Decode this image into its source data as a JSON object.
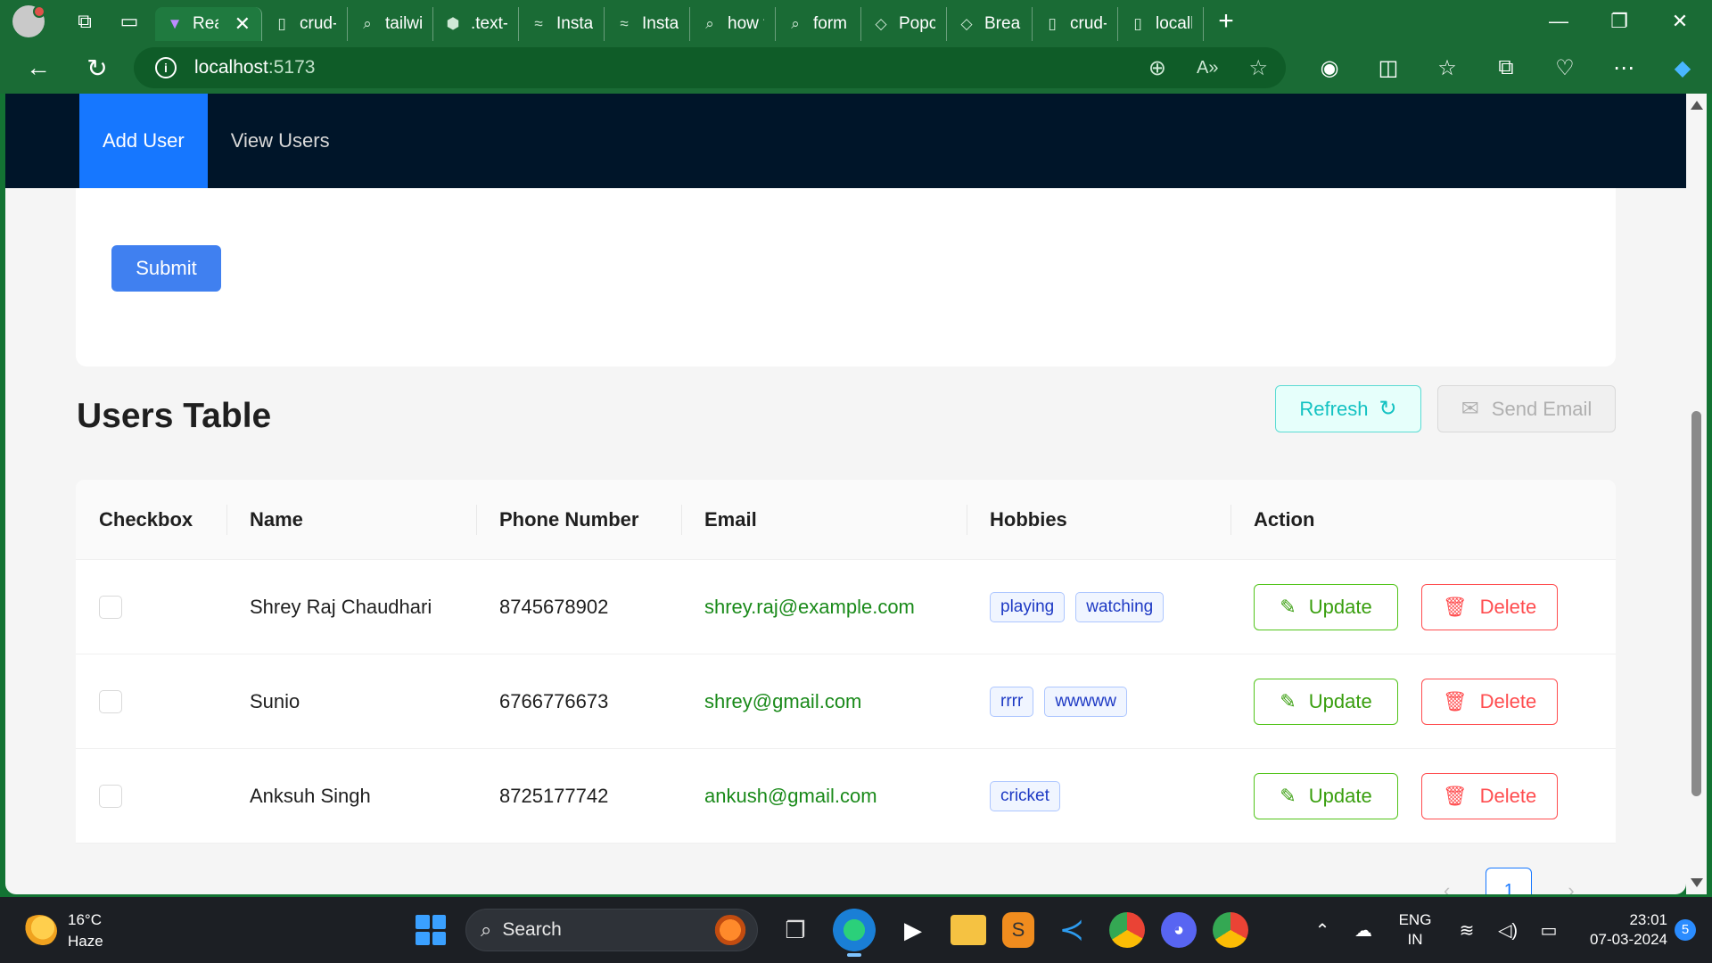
{
  "browser": {
    "tabs": [
      {
        "label": "Rea",
        "icon": "vite-icon",
        "active": true
      },
      {
        "label": "crud-us",
        "icon": "page-icon"
      },
      {
        "label": "tailwind",
        "icon": "search-icon"
      },
      {
        "label": ".text-blu",
        "icon": "cube-icon"
      },
      {
        "label": "Install T",
        "icon": "tailwind-icon"
      },
      {
        "label": "Install T",
        "icon": "tailwind-icon"
      },
      {
        "label": "how to",
        "icon": "search-icon"
      },
      {
        "label": "form de",
        "icon": "search-icon"
      },
      {
        "label": "Popcon",
        "icon": "diamond-icon"
      },
      {
        "label": "Breadcr",
        "icon": "diamond-icon"
      },
      {
        "label": "crud-us",
        "icon": "page-icon"
      },
      {
        "label": "localho",
        "icon": "page-icon"
      }
    ],
    "url_host": "localhost",
    "url_port": ":5173"
  },
  "app": {
    "nav": {
      "add_user": "Add User",
      "view_users": "View Users"
    },
    "submit_label": "Submit",
    "table_title": "Users Table",
    "refresh_label": "Refresh",
    "send_email_label": "Send Email",
    "columns": [
      "Checkbox",
      "Name",
      "Phone Number",
      "Email",
      "Hobbies",
      "Action"
    ],
    "rows": [
      {
        "name": "Shrey Raj Chaudhari",
        "phone": "8745678902",
        "email": "shrey.raj@example.com",
        "hobbies": [
          "playing",
          "watching"
        ]
      },
      {
        "name": "Sunio",
        "phone": "6766776673",
        "email": "shrey@gmail.com",
        "hobbies": [
          "rrrr",
          "wwwww"
        ]
      },
      {
        "name": "Anksuh Singh",
        "phone": "8725177742",
        "email": "ankush@gmail.com",
        "hobbies": [
          "cricket"
        ]
      }
    ],
    "update_label": "Update",
    "delete_label": "Delete",
    "current_page": "1"
  },
  "taskbar": {
    "weather_temp": "16°C",
    "weather_desc": "Haze",
    "search_placeholder": "Search",
    "lang_top": "ENG",
    "lang_bottom": "IN",
    "time": "23:01",
    "date": "07-03-2024",
    "notif_count": "5"
  }
}
